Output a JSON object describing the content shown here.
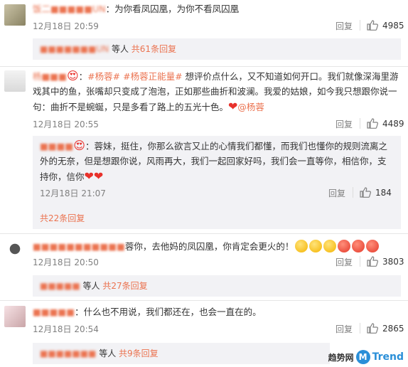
{
  "comments": [
    {
      "user": "饭二■■■■■UN",
      "text": "为你看凤囚凰，为你不看凤囚凰",
      "time": "12月18日 20:59",
      "reply": "回复",
      "likes": "4985",
      "summary_user": "■■■■■■■UN",
      "summary_mid": "等人",
      "summary_count": "共61条回复"
    },
    {
      "user": "杨■■■",
      "tags": [
        "#杨蓉",
        "#杨蓉正能量#"
      ],
      "text": "想评价点什么，又不知道如何开口。我们就像深海里游戏其中的鱼，张嘴却只变成了泡泡，正如那些曲折和波澜。我爱的姑娘，如今我只想跟你说一句：曲折不是蜿蜒，只是多看了路上的五光十色。",
      "mention": "@杨蓉",
      "time": "12月18日 20:55",
      "reply": "回复",
      "likes": "4489",
      "sub": {
        "user": "■■■■",
        "text": "蓉妹，挺住，你那么欲言又止的心情我们都懂，而我们也懂你的规则流离之外的无奈，但是想跟你说，风雨再大，我们一起回家好吗，我们会一直等你，相信你，支持你，信你",
        "time": "12月18日 21:07",
        "reply": "回复",
        "likes": "184"
      },
      "expand": "共22条回复"
    },
    {
      "user": "■■■■■■■■■■■",
      "text": "蓉你，去他妈的凤囚凰，你肯定会更火的！",
      "time": "12月18日 20:50",
      "reply": "回复",
      "likes": "3803",
      "summary_user": "■■■■■",
      "summary_mid": "等人",
      "summary_count": "共27条回复"
    },
    {
      "user": "■■■■■",
      "text": "什么也不用说，我们都还在，也会一直在的。",
      "time": "12月18日 20:54",
      "reply": "回复",
      "likes": "2865",
      "summary_user": "■■■■■■■",
      "summary_mid": "等人",
      "summary_count": "共9条回复"
    }
  ],
  "watermark": {
    "cn": "趋势网",
    "m": "M",
    "en": "Trend"
  },
  "colors": {
    "accent": "#eb7350",
    "like_icon": "#808080",
    "panel": "#f2f2f5"
  }
}
